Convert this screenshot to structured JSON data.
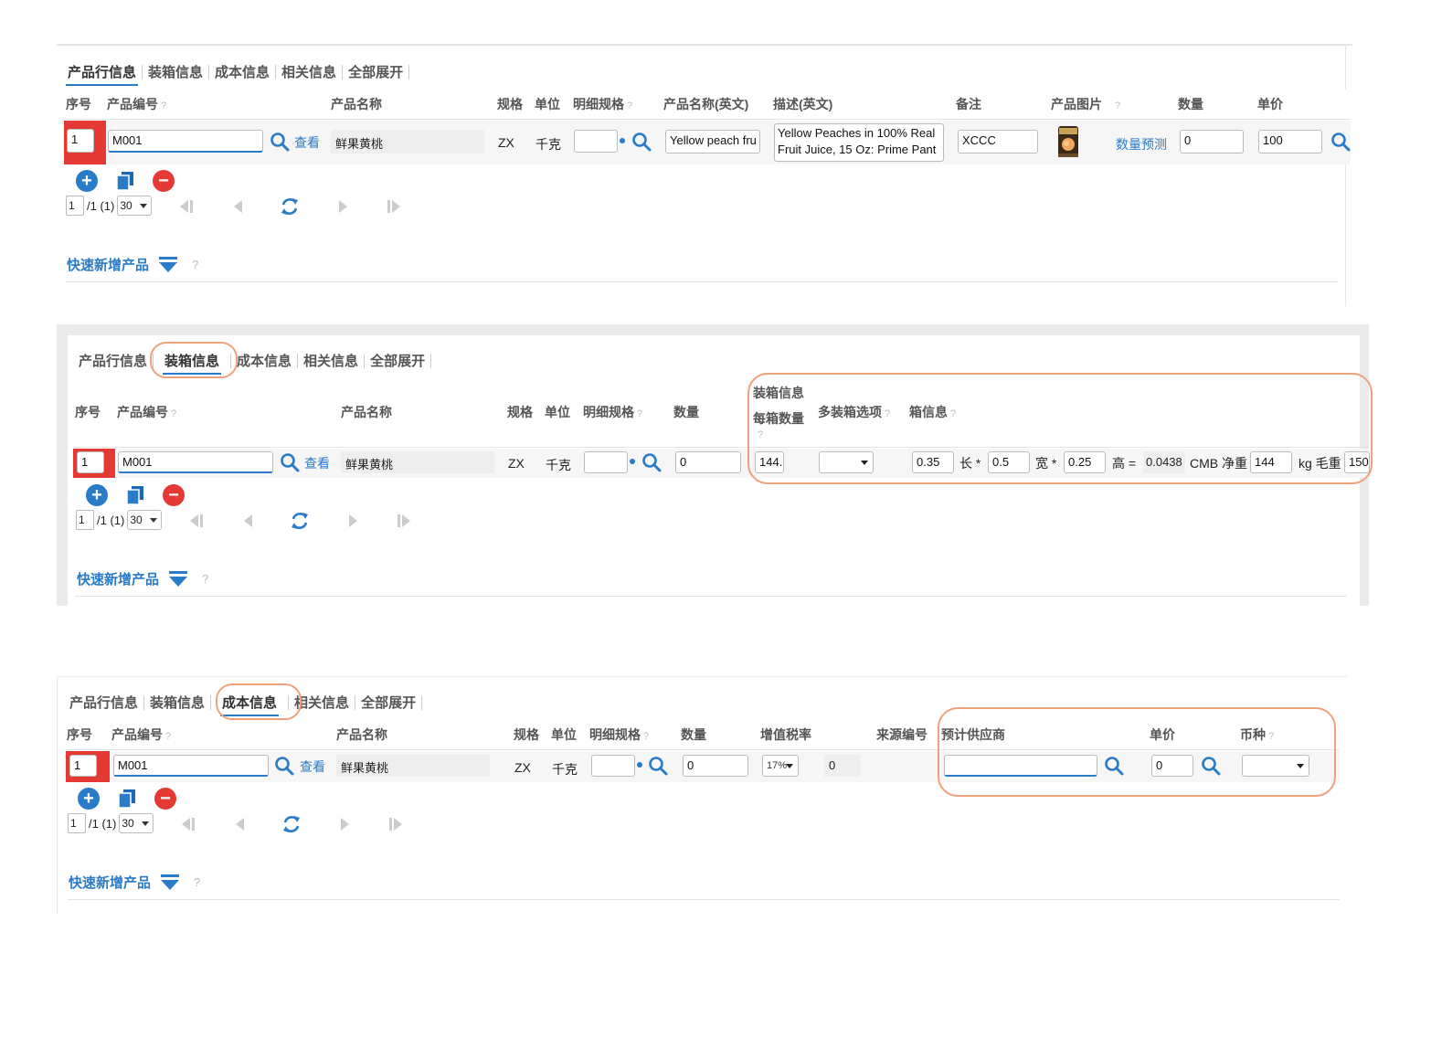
{
  "tabs": [
    "产品行信息",
    "装箱信息",
    "成本信息",
    "相关信息",
    "全部展开"
  ],
  "common": {
    "seq_header": "序号",
    "code_header": "产品编号",
    "name_header": "产品名称",
    "spec_header": "规格",
    "unit_header": "单位",
    "detail_spec_header": "明细规格",
    "qty_header": "数量",
    "seq_value": "1",
    "code_value": "M001",
    "view_link": "查看",
    "name_value": "鲜果黄桃",
    "spec_value": "ZX",
    "unit_value": "千克",
    "qty_value": "0",
    "page_input": "1",
    "page_total": "/1 (1)",
    "page_size": "30",
    "quick_add": "快速新增产品",
    "help": "?"
  },
  "panel1": {
    "en_name_header": "产品名称(英文)",
    "desc_header": "描述(英文)",
    "remark_header": "备注",
    "image_header": "产品图片",
    "price_header": "单价",
    "en_name_value": "Yellow peach fru",
    "desc_value_line1": "Yellow Peaches in 100% Real",
    "desc_value_line2": "Fruit Juice, 15 Oz: Prime Pant",
    "remark_value": "XCCC",
    "forecast_link": "数量预测",
    "qty_value": "0",
    "price_value": "100"
  },
  "panel2": {
    "packing_group": "装箱信息",
    "per_box_header": "每箱数量",
    "multi_box_header": "多装箱选项",
    "box_info_header": "箱信息",
    "per_box_value": "144.",
    "length_value": "0.35",
    "length_label": "长 *",
    "width_value": "0.5",
    "width_label": "宽 *",
    "height_value": "0.25",
    "height_label": "高 =",
    "cbm_value": "0.0438",
    "cbm_label": "CMB 净重",
    "net_value": "144",
    "gross_label": "kg 毛重",
    "gross_value": "150"
  },
  "panel3": {
    "tax_header": "增值税率",
    "source_header": "来源编号",
    "supplier_header": "预计供应商",
    "price_header": "单价",
    "currency_header": "币种",
    "tax_value": "17%",
    "source_value": "0",
    "supplier_value": "",
    "price_value": "0",
    "currency_value": ""
  },
  "colors": {
    "accent": "#2a7bc8",
    "danger": "#e53935",
    "highlight": "#f0a07a"
  }
}
